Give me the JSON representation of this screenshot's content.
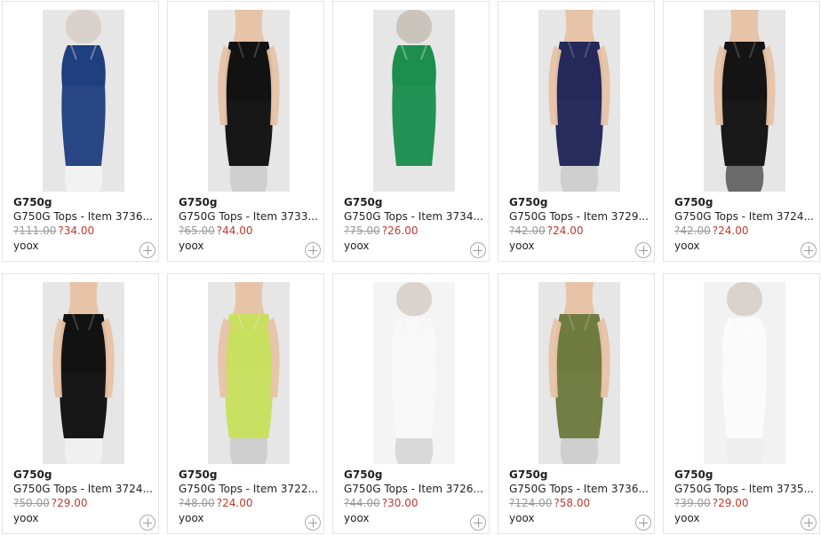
{
  "products": [
    {
      "brand": "G750g",
      "title": "G750G Tops - Item 3736...",
      "old_price": "?111.00",
      "new_price": "?34.00",
      "store": "yoox",
      "colors": {
        "top": "#1f3f7f",
        "bottom": "#f2f2f2",
        "skin": "#d7d0ca",
        "bg": "#e6e6e6"
      },
      "type": "mannequin",
      "icon": "plus-circle-icon"
    },
    {
      "brand": "G750g",
      "title": "G750G Tops - Item 3733...",
      "old_price": "?65.00",
      "new_price": "?44.00",
      "store": "yoox",
      "colors": {
        "top": "#121212",
        "bottom": "#cfcfcf",
        "skin": "#e7c3a6",
        "bg": "#e6e6e6"
      },
      "type": "model",
      "icon": "plus-circle-icon"
    },
    {
      "brand": "G750g",
      "title": "G750G Tops - Item 3734...",
      "old_price": "?75.00",
      "new_price": "?26.00",
      "store": "yoox",
      "colors": {
        "top": "#1c8f4e",
        "bottom": "#e6e6e6",
        "skin": "#c9c2bb",
        "bg": "#e6e6e6"
      },
      "type": "mannequin",
      "icon": "plus-circle-icon"
    },
    {
      "brand": "G750g",
      "title": "G750G Tops - Item 3729...",
      "old_price": "?42.00",
      "new_price": "?24.00",
      "store": "yoox",
      "colors": {
        "top": "#24295a",
        "bottom": "#cfcfcf",
        "skin": "#e7c3a6",
        "bg": "#e6e6e6"
      },
      "type": "model",
      "icon": "plus-circle-icon"
    },
    {
      "brand": "G750g",
      "title": "G750G Tops - Item 3724...",
      "old_price": "?42.00",
      "new_price": "?24.00",
      "store": "yoox",
      "colors": {
        "top": "#141414",
        "bottom": "#6b6b6b",
        "skin": "#e7c3a6",
        "bg": "#e6e6e6"
      },
      "type": "model",
      "icon": "plus-circle-icon"
    },
    {
      "brand": "G750g",
      "title": "G750G Tops - Item 3724...",
      "old_price": "?50.00",
      "new_price": "?29.00",
      "store": "yoox",
      "colors": {
        "top": "#121212",
        "bottom": "#f0f0f0",
        "skin": "#e7c3a6",
        "bg": "#e6e6e6"
      },
      "type": "model",
      "icon": "plus-circle-icon"
    },
    {
      "brand": "G750g",
      "title": "G750G Tops - Item 3722...",
      "old_price": "?48.00",
      "new_price": "?24.00",
      "store": "yoox",
      "colors": {
        "top": "#c8df5f",
        "bottom": "#cfcfcf",
        "skin": "#e7c3a6",
        "bg": "#e6e6e6"
      },
      "type": "model",
      "icon": "plus-circle-icon"
    },
    {
      "brand": "G750g",
      "title": "G750G Tops - Item 3726...",
      "old_price": "?44.00",
      "new_price": "?30.00",
      "store": "yoox",
      "colors": {
        "top": "#f8f8f8",
        "bottom": "#d9d9d9",
        "skin": "#d7d0ca",
        "bg": "#f4f4f4"
      },
      "type": "mannequin",
      "icon": "plus-circle-icon"
    },
    {
      "brand": "G750g",
      "title": "G750G Tops - Item 3736...",
      "old_price": "?124.00",
      "new_price": "?58.00",
      "store": "yoox",
      "colors": {
        "top": "#6f7b3f",
        "bottom": "#cfcfcf",
        "skin": "#e7c3a6",
        "bg": "#e6e6e6"
      },
      "type": "model",
      "icon": "plus-circle-icon"
    },
    {
      "brand": "G750g",
      "title": "G750G Tops - Item 3735...",
      "old_price": "?39.00",
      "new_price": "?29.00",
      "store": "yoox",
      "colors": {
        "top": "#fbfbfb",
        "bottom": "#eeeeee",
        "skin": "#d7d0ca",
        "bg": "#f2f2f2"
      },
      "type": "mannequin",
      "icon": "plus-circle-icon"
    }
  ]
}
